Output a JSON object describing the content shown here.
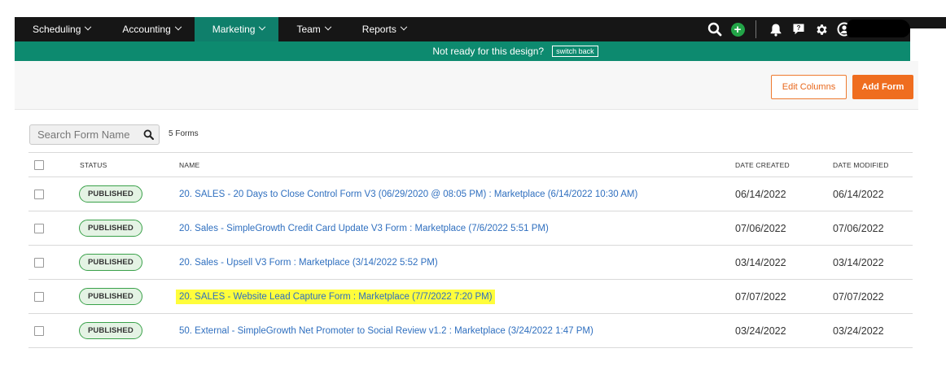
{
  "nav": {
    "items": [
      {
        "label": "Scheduling"
      },
      {
        "label": "Accounting"
      },
      {
        "label": "Marketing"
      },
      {
        "label": "Team"
      },
      {
        "label": "Reports"
      }
    ],
    "active_index": 2,
    "icons": [
      "search-icon",
      "add-circle-icon",
      "bell-icon",
      "help-icon",
      "gear-icon",
      "user-icon"
    ]
  },
  "banner": {
    "text": "Not ready for this design?",
    "switch_label": "switch back"
  },
  "toolbar": {
    "edit_columns_label": "Edit Columns",
    "add_form_label": "Add Form"
  },
  "search": {
    "placeholder": "Search Form Name",
    "count_text": "5 Forms"
  },
  "table": {
    "headers": {
      "status": "STATUS",
      "name": "NAME",
      "date_created": "DATE CREATED",
      "date_modified": "DATE MODIFIED"
    },
    "rows": [
      {
        "status": "PUBLISHED",
        "name": "20. SALES - 20 Days to Close Control Form V3 (06/29/2020 @ 08:05 PM) : Marketplace (6/14/2022 10:30 AM)",
        "created": "06/14/2022",
        "modified": "06/14/2022"
      },
      {
        "status": "PUBLISHED",
        "name": "20. Sales - SimpleGrowth Credit Card Update V3 Form : Marketplace (7/6/2022 5:51 PM)",
        "created": "07/06/2022",
        "modified": "07/06/2022"
      },
      {
        "status": "PUBLISHED",
        "name": "20. Sales - Upsell V3 Form : Marketplace (3/14/2022 5:52 PM)",
        "created": "03/14/2022",
        "modified": "03/14/2022"
      },
      {
        "status": "PUBLISHED",
        "name": "20. SALES - Website Lead Capture Form : Marketplace (7/7/2022 7:20 PM)",
        "created": "07/07/2022",
        "modified": "07/07/2022"
      },
      {
        "status": "PUBLISHED",
        "name": "50. External - SimpleGrowth Net Promoter to Social Review v1.2 : Marketplace (3/24/2022 1:47 PM)",
        "created": "03/24/2022",
        "modified": "03/24/2022"
      }
    ],
    "highlighted_row_index": 3
  },
  "colors": {
    "nav_bg": "#161616",
    "nav_active": "#0f7f6b",
    "banner_bg": "#0d8a6f",
    "accent_orange": "#ef6d1f",
    "link_blue": "#2f6fbf",
    "badge_green": "#3aa14a",
    "highlight_yellow": "#fffd3b"
  }
}
